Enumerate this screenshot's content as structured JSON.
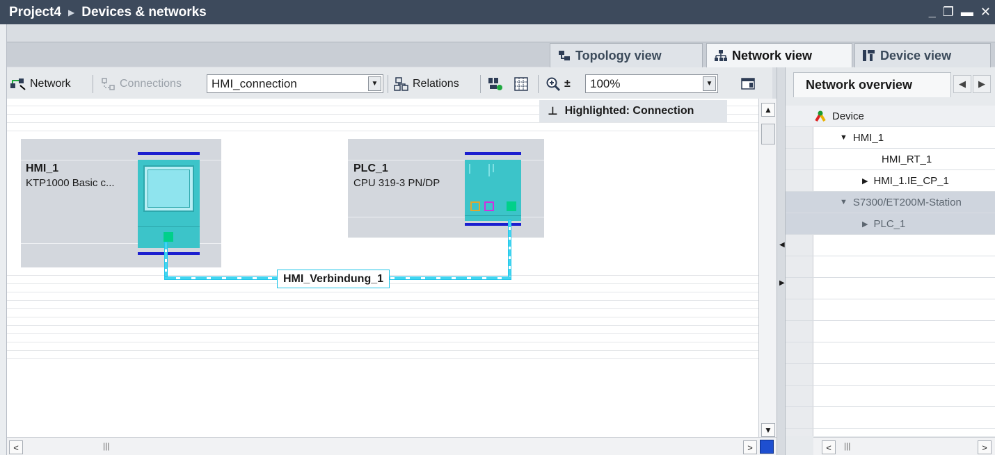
{
  "title": {
    "project": "Project4",
    "separator": "▶",
    "section": "Devices & networks"
  },
  "window_controls": {
    "minimize": "_",
    "restore": "❐",
    "maximize": "▬",
    "close": "✕"
  },
  "tabs": [
    {
      "label": "Topology view",
      "icon": "topology-icon",
      "active": false
    },
    {
      "label": "Network view",
      "icon": "network-icon",
      "active": true
    },
    {
      "label": "Device view",
      "icon": "device-icon",
      "active": false
    }
  ],
  "toolbar": {
    "network_label": "Network",
    "connections_label": "Connections",
    "connection_type": "HMI_connection",
    "relations_label": "Relations",
    "zoom_value": "100%",
    "zoom_in_symbol": "±"
  },
  "highlight": {
    "pin": "⊥",
    "text": "Highlighted: Connection"
  },
  "devices": [
    {
      "name": "HMI_1",
      "type": "KTP1000 Basic c..."
    },
    {
      "name": "PLC_1",
      "type": "CPU 319-3 PN/DP"
    }
  ],
  "connection": {
    "label": "HMI_Verbindung_1"
  },
  "overview": {
    "tab_label": "Network overview",
    "nav_prev": "◀",
    "nav_next": "▶",
    "column_header": "Device",
    "rows": [
      {
        "label": "HMI_1",
        "expander": "▼",
        "level": 0,
        "selected": false
      },
      {
        "label": "HMI_RT_1",
        "expander": "",
        "level": 1,
        "selected": false
      },
      {
        "label": "HMI_1.IE_CP_1",
        "expander": "▶",
        "level": 1,
        "selected": false
      },
      {
        "label": "S7300/ET200M-Station",
        "expander": "▼",
        "level": 0,
        "selected": true
      },
      {
        "label": "PLC_1",
        "expander": "▶",
        "level": 1,
        "selected": true
      }
    ]
  },
  "scroll": {
    "up": "▲",
    "down": "▼",
    "left": "<",
    "right": ">",
    "grip": "|||"
  },
  "colors": {
    "title_bg": "#3d4a5c",
    "device_bg": "#d3d7dd",
    "device_body": "#3cc4c9",
    "connection": "#41d6f0",
    "rail": "#1b1ecf",
    "port": "#00d08a"
  }
}
